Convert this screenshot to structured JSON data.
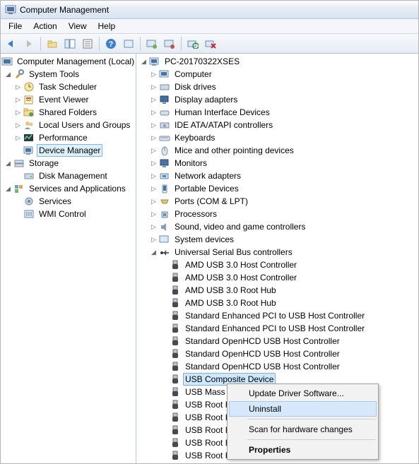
{
  "title": "Computer Management",
  "menu": {
    "file": "File",
    "action": "Action",
    "view": "View",
    "help": "Help"
  },
  "left": {
    "root": "Computer Management (Local)",
    "systools": "System Tools",
    "tasksched": "Task Scheduler",
    "eventviewer": "Event Viewer",
    "sharedfolders": "Shared Folders",
    "localusers": "Local Users and Groups",
    "performance": "Performance",
    "devmgr": "Device Manager",
    "storage": "Storage",
    "diskmgmt": "Disk Management",
    "svcapps": "Services and Applications",
    "services": "Services",
    "wmi": "WMI Control"
  },
  "right": {
    "root": "PC-20170322XSES",
    "computer": "Computer",
    "diskdrives": "Disk drives",
    "displayadapters": "Display adapters",
    "hid": "Human Interface Devices",
    "ide": "IDE ATA/ATAPI controllers",
    "keyboards": "Keyboards",
    "mice": "Mice and other pointing devices",
    "monitors": "Monitors",
    "netadapters": "Network adapters",
    "portable": "Portable Devices",
    "ports": "Ports (COM & LPT)",
    "processors": "Processors",
    "sound": "Sound, video and game controllers",
    "sysdev": "System devices",
    "usb": "Universal Serial Bus controllers",
    "usb_items": {
      "a1": "AMD USB 3.0 Host Controller",
      "a2": "AMD USB 3.0 Host Controller",
      "a3": "AMD USB 3.0 Root Hub",
      "a4": "AMD USB 3.0 Root Hub",
      "s1": "Standard Enhanced PCI to USB Host Controller",
      "s2": "Standard Enhanced PCI to USB Host Controller",
      "s3": "Standard OpenHCD USB Host Controller",
      "s4": "Standard OpenHCD USB Host Controller",
      "s5": "Standard OpenHCD USB Host Controller",
      "comp": "USB Composite Device",
      "mass": "USB Mass Storage Device",
      "rh1": "USB Root Hub",
      "rh2": "USB Root Hub",
      "rh3": "USB Root Hub",
      "rh4": "USB Root Hub",
      "rh5": "USB Root Hub"
    }
  },
  "ctx": {
    "update": "Update Driver Software...",
    "uninstall": "Uninstall",
    "scan": "Scan for hardware changes",
    "props": "Properties"
  }
}
